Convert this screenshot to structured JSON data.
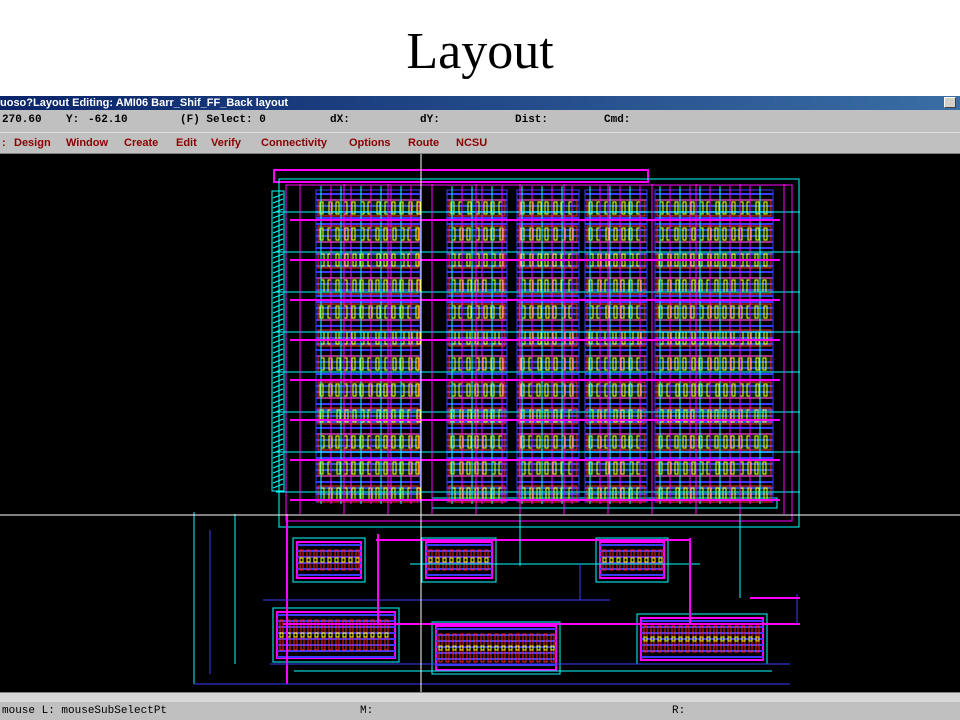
{
  "slide": {
    "title": "Layout"
  },
  "window": {
    "title": "uoso?Layout Editing: AMI06 Barr_Shif_FF_Back layout"
  },
  "status": {
    "x": "270.60",
    "y_label": "Y:",
    "y": "-62.10",
    "select": "(F) Select: 0",
    "dx": "dX:",
    "dy": "dY:",
    "dist": "Dist:",
    "cmd": "Cmd:"
  },
  "menu": [
    "Design",
    "Window",
    "Create",
    "Edit",
    "Verify",
    "Connectivity",
    "Options",
    "Route",
    "NCSU"
  ],
  "bottom": {
    "mouse_l": "mouse L: mouseSubSelectPt",
    "m": "M:",
    "r": "R:"
  },
  "colors": {
    "canvas": "#000000",
    "metal1": "#3b3bff",
    "metal2": "#ff00ff",
    "poly": "#ff2020",
    "active": "#00c060",
    "well": "#00ffff",
    "via": "#ffff00",
    "crosshair": "#ffffff"
  }
}
